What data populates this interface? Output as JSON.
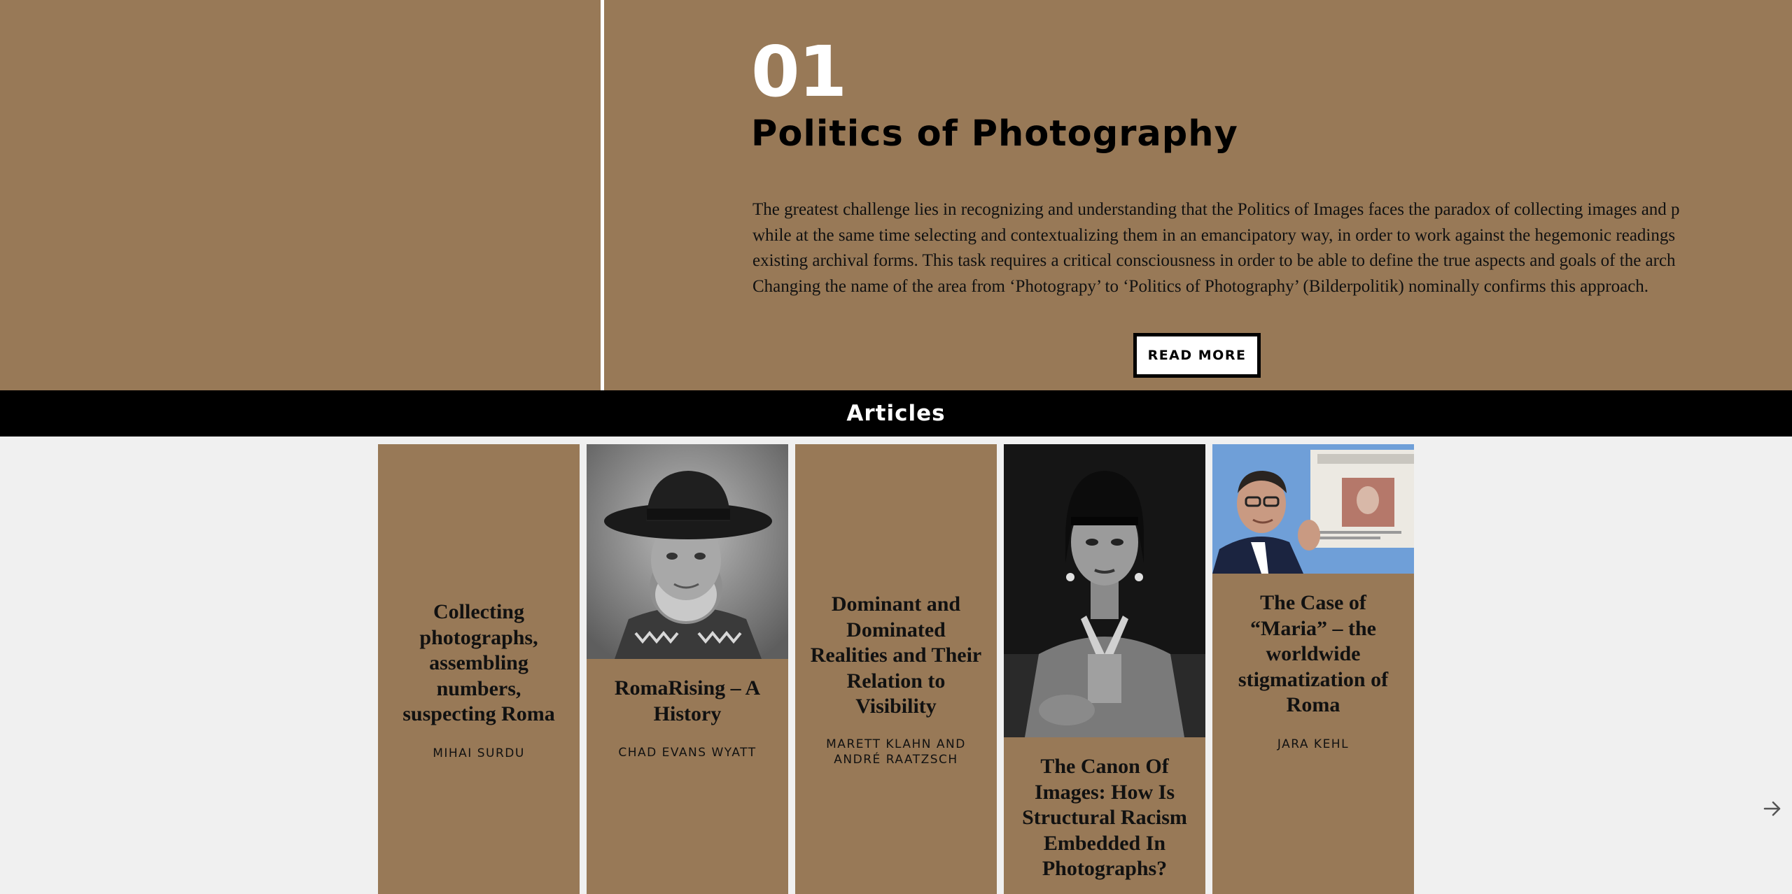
{
  "hero": {
    "number": "01",
    "title": "Politics of Photography",
    "paragraph_lines": [
      "The greatest challenge lies in recognizing and understanding that the Politics of Images faces the paradox of collecting images and p",
      "while at the same time selecting and contextualizing them in an emancipatory way, in order to work against the hegemonic readings",
      "existing archival forms. This task requires a critical consciousness in order to be able to define the true aspects and goals of the arch",
      "Changing the name of the area from ‘Photograpy’ to ‘Politics of Photography’ (Bilderpolitik) nominally confirms this approach."
    ],
    "read_more_label": "READ MORE"
  },
  "articles": {
    "heading": "Articles",
    "cards": [
      {
        "title": "Collecting photographs, assembling numbers, suspecting Roma",
        "author": "MIHAI SURDU",
        "image": "none"
      },
      {
        "title": "RomaRising – A History",
        "author": "CHAD EVANS WYATT",
        "image": "portrait of man in black hat (black and white)"
      },
      {
        "title": "Dominant and Dominated Realities and Their Relation to Visibility",
        "author": "MARETT KLAHN AND ANDRÉ RAATZSCH",
        "image": "none"
      },
      {
        "title": "The Canon Of Images: How Is Structural Racism Embedded In Photographs?",
        "author": "",
        "image": "portrait of performer with fringe wig (black and white)"
      },
      {
        "title": "The Case of “Maria” – the worldwide stigmatization of Roma",
        "author": "JARA KEHL",
        "image": "man holding up International New York Times newspaper"
      }
    ],
    "next_icon": "arrow-right-icon"
  },
  "colors": {
    "hero_bg": "#987957",
    "card_bg": "#987957",
    "bar_bg": "#000000",
    "page_bg": "#f0f0f0",
    "accent_white": "#ffffff"
  }
}
